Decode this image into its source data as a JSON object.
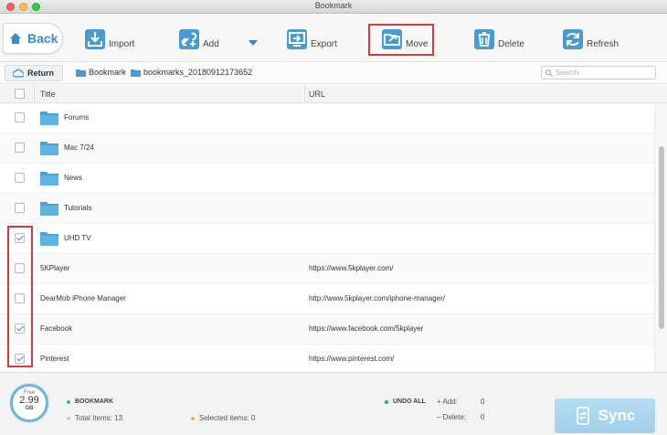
{
  "window": {
    "title": "Bookmark"
  },
  "toolbar": {
    "back_label": "Back",
    "import_label": "Import",
    "add_label": "Add",
    "export_label": "Export",
    "move_label": "Move",
    "delete_label": "Delete",
    "refresh_label": "Refresh"
  },
  "nav": {
    "return_label": "Return",
    "breadcrumb": [
      "Bookmark",
      "bookmarks_20180912173652"
    ],
    "search_placeholder": "Search"
  },
  "table": {
    "headers": {
      "title": "Title",
      "url": "URL"
    },
    "rows": [
      {
        "type": "folder",
        "title": "Forums",
        "url": "",
        "checked": false
      },
      {
        "type": "folder",
        "title": "Mac 7/24",
        "url": "",
        "checked": false
      },
      {
        "type": "folder",
        "title": "News",
        "url": "",
        "checked": false
      },
      {
        "type": "folder",
        "title": "Tutorials",
        "url": "",
        "checked": false
      },
      {
        "type": "folder",
        "title": "UHD TV",
        "url": "",
        "checked": true
      },
      {
        "type": "bookmark",
        "title": "5KPlayer",
        "url": "https://www.5kplayer.com/",
        "checked": false
      },
      {
        "type": "bookmark",
        "title": "DearMob iPhone Manager",
        "url": "http://www.5kplayer.com/iphone-manager/",
        "checked": false
      },
      {
        "type": "bookmark",
        "title": "Facebook",
        "url": "https://www.facebook.com/5kplayer",
        "checked": true
      },
      {
        "type": "bookmark",
        "title": "Pinterest",
        "url": "https://www.pinterest.com/",
        "checked": true
      }
    ]
  },
  "footer": {
    "storage": {
      "free_label": "Free",
      "value": "2.99",
      "unit": "GB"
    },
    "section_label": "BOOKMARK",
    "total_label": "Total Items: 13",
    "selected_label": "Selected items: 0",
    "undo_label": "UNDO ALL",
    "add_label": "Add:",
    "add_count": "0",
    "delete_label": "Delete:",
    "delete_count": "0",
    "sync_label": "Sync"
  },
  "colors": {
    "accent": "#3a8fc4",
    "highlight": "#d43b3b",
    "bookmark_dot": "#34b3d9",
    "total_dot": "#c8c8c8",
    "selected_dot": "#f2b62b",
    "undo_dot": "#2fae5a"
  }
}
